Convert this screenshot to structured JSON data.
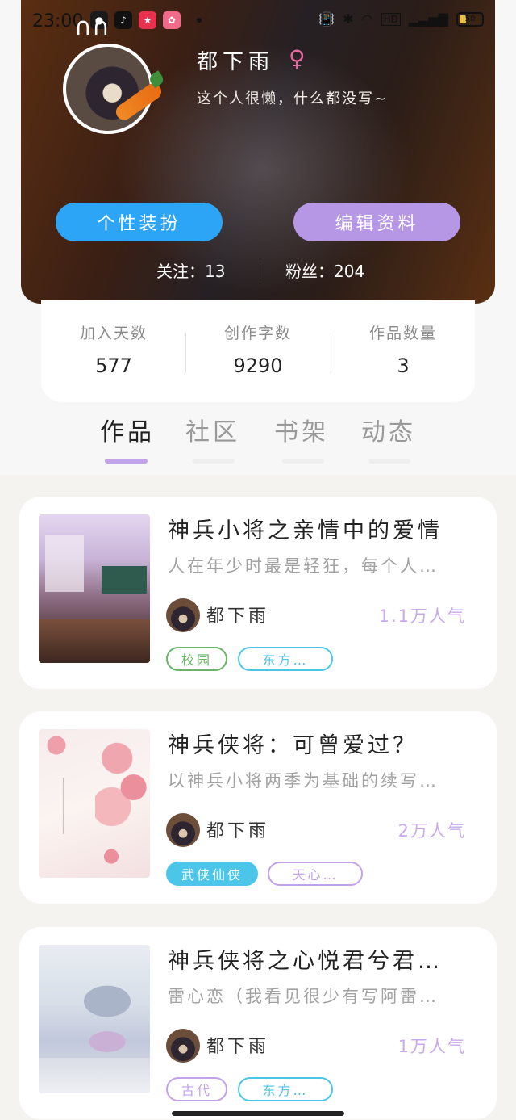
{
  "status_bar": {
    "time": "23:00",
    "battery": "50"
  },
  "profile": {
    "name": "都下雨",
    "gender_symbol": "♀",
    "bio": "这个人很懒，什么都没写~",
    "dressup_button": "个性装扮",
    "edit_button": "编辑资料",
    "following_label": "关注：13",
    "followers_label": "粉丝：204"
  },
  "stats": [
    {
      "label": "加入天数",
      "value": "577"
    },
    {
      "label": "创作字数",
      "value": "9290"
    },
    {
      "label": "作品数量",
      "value": "3"
    }
  ],
  "tabs": [
    {
      "label": "作品",
      "active": true
    },
    {
      "label": "社区",
      "active": false
    },
    {
      "label": "书架",
      "active": false
    },
    {
      "label": "动态",
      "active": false
    }
  ],
  "works": [
    {
      "title": "神兵小将之亲情中的爱情",
      "desc": "人在年少时最是轻狂，每个人…",
      "author": "都下雨",
      "popularity": "1.1万人气",
      "tags": [
        "校园",
        "东方…"
      ]
    },
    {
      "title": "神兵侠将：可曾爱过？",
      "desc": "以神兵小将两季为基础的续写…",
      "author": "都下雨",
      "popularity": "2万人气",
      "tags": [
        "武侠仙侠",
        "天心…"
      ]
    },
    {
      "title": "神兵侠将之心悦君兮君…",
      "desc": "雷心恋（我看见很少有写阿雷…",
      "author": "都下雨",
      "popularity": "1万人气",
      "tags": [
        "古代",
        "东方…"
      ]
    }
  ],
  "colors": {
    "accent_blue": "#2da5f6",
    "accent_purple": "#b697e6",
    "tag_green": "#6ab46a",
    "tag_cyan": "#4cc6e8",
    "tag_purple": "#c3a2ec",
    "popularity": "#c9a9ee"
  }
}
